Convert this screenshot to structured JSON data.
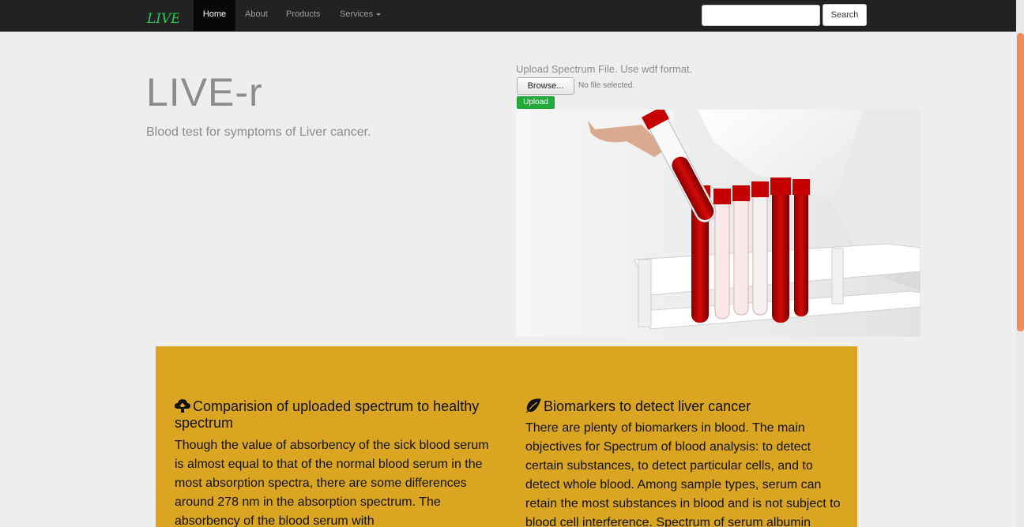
{
  "navbar": {
    "brand": "LIVE-r",
    "items": [
      {
        "label": "Home",
        "active": true
      },
      {
        "label": "About",
        "active": false
      },
      {
        "label": "Products",
        "active": false
      },
      {
        "label": "Services",
        "active": false,
        "dropdown": true
      }
    ],
    "search": {
      "placeholder": "",
      "button": "Search"
    }
  },
  "hero": {
    "title": "LIVE-r",
    "subtitle": "Blood test for symptoms of Liver cancer."
  },
  "upload": {
    "label": "Upload Spectrum File. Use wdf format.",
    "browse_button": "Browse...",
    "file_status": "No file selected.",
    "upload_button": "Upload"
  },
  "sections": {
    "left": {
      "icon": "cloud-upload-icon",
      "heading": "Comparision of uploaded spectrum to healthy spectrum",
      "body": "Though the value of absorbency of the sick blood serum is almost equal to that of the normal blood serum in the most absorption spectra, there are some differences around 278 nm in the absorption spectrum. The absorbency of the blood serum with"
    },
    "right": {
      "icon": "leaf-icon",
      "heading": "Biomarkers to detect liver cancer",
      "body": "There are plenty of biomarkers in blood. The main objectives for Spectrum of blood analysis: to detect certain substances, to detect particular cells, and to detect whole blood. Among sample types, serum can retain the most substances in blood and is not subject to blood cell interference. Spectrum of serum albumin"
    }
  },
  "colors": {
    "navbar_bg": "#222222",
    "panel_bg": "#daa520",
    "upload_green": "#23a83a",
    "brand_green": "#22cc55",
    "scroll_accent": "#f08a5d"
  }
}
